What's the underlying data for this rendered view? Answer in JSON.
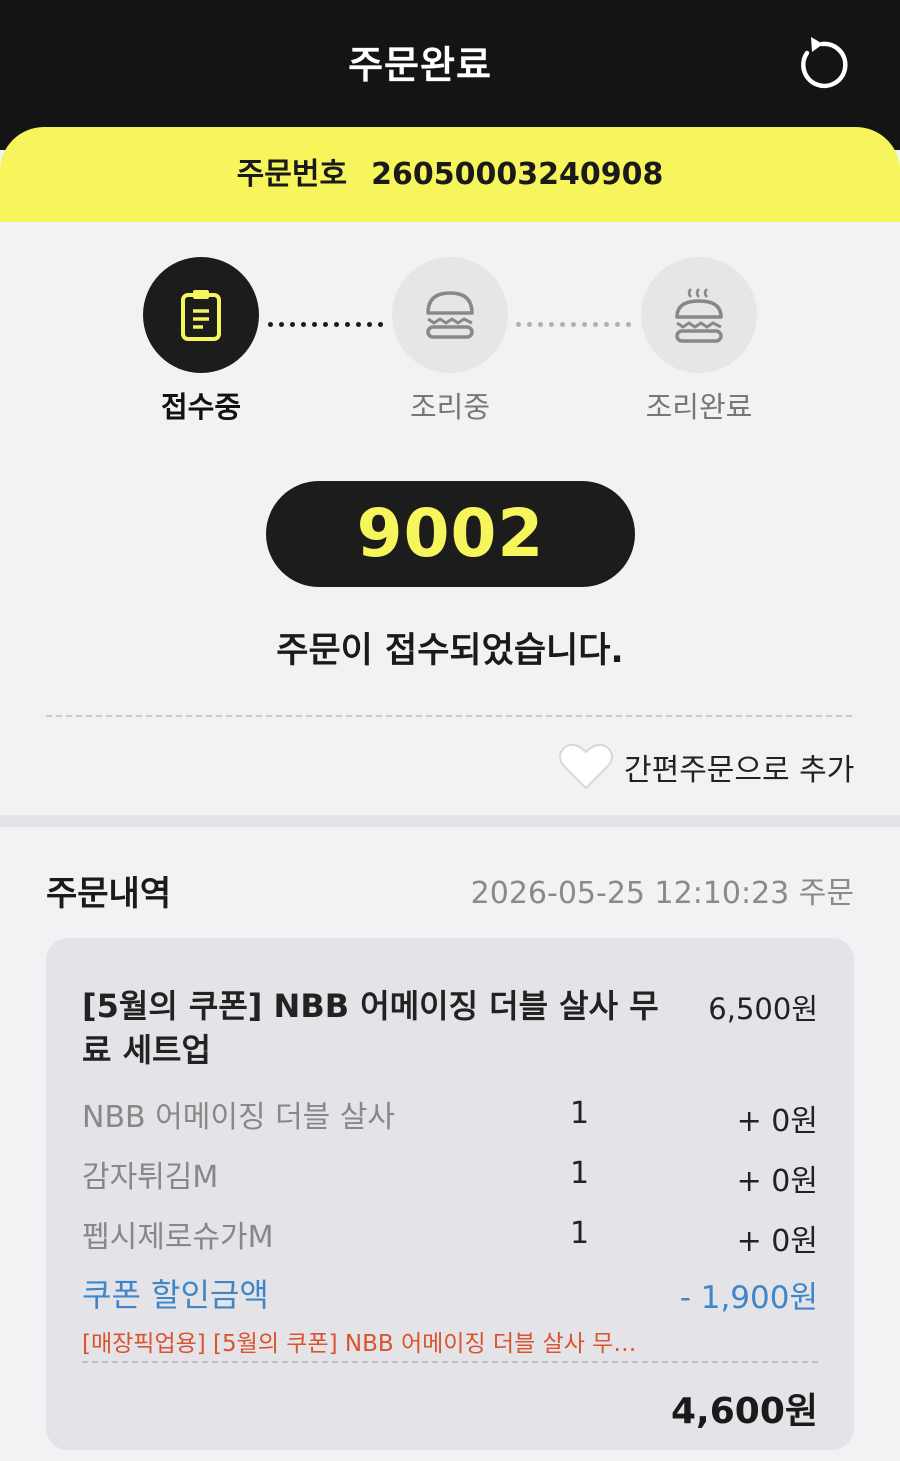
{
  "header": {
    "title": "주문완료",
    "refresh_icon": "refresh-icon"
  },
  "order": {
    "number_label": "주문번호",
    "number": "26050003240908"
  },
  "progress": {
    "steps": [
      {
        "label": "접수중",
        "icon": "clipboard-icon",
        "active": true
      },
      {
        "label": "조리중",
        "icon": "burger-icon",
        "active": false
      },
      {
        "label": "조리완료",
        "icon": "hot-burger-icon",
        "active": false
      }
    ]
  },
  "pickup_number": "9002",
  "status_message": "주문이 접수되었습니다.",
  "favorite": {
    "label": "간편주문으로 추가",
    "icon": "heart-icon"
  },
  "history": {
    "title": "주문내역",
    "datetime": "2026-05-25  12:10:23   주문",
    "item": {
      "name": "[5월의 쿠폰] NBB 어메이징 더블 살사 무료 세트업",
      "price": "6,500원",
      "options": [
        {
          "name": "NBB 어메이징 더블 살사",
          "qty": "1",
          "price": "+ 0원"
        },
        {
          "name": "감자튀김M",
          "qty": "1",
          "price": "+ 0원"
        },
        {
          "name": "펩시제로슈가M",
          "qty": "1",
          "price": "+ 0원"
        }
      ],
      "coupon_label": "쿠폰 할인금액",
      "coupon_amount": "- 1,900원",
      "coupon_note": "[매장픽업용] [5월의 쿠폰] NBB 어메이징 더블 살사 무료…",
      "total": "4,600원"
    }
  },
  "colors": {
    "accent_yellow": "#f7f55c",
    "dark": "#141414",
    "coupon_blue": "#3f86c8",
    "note_red": "#d9532f"
  }
}
